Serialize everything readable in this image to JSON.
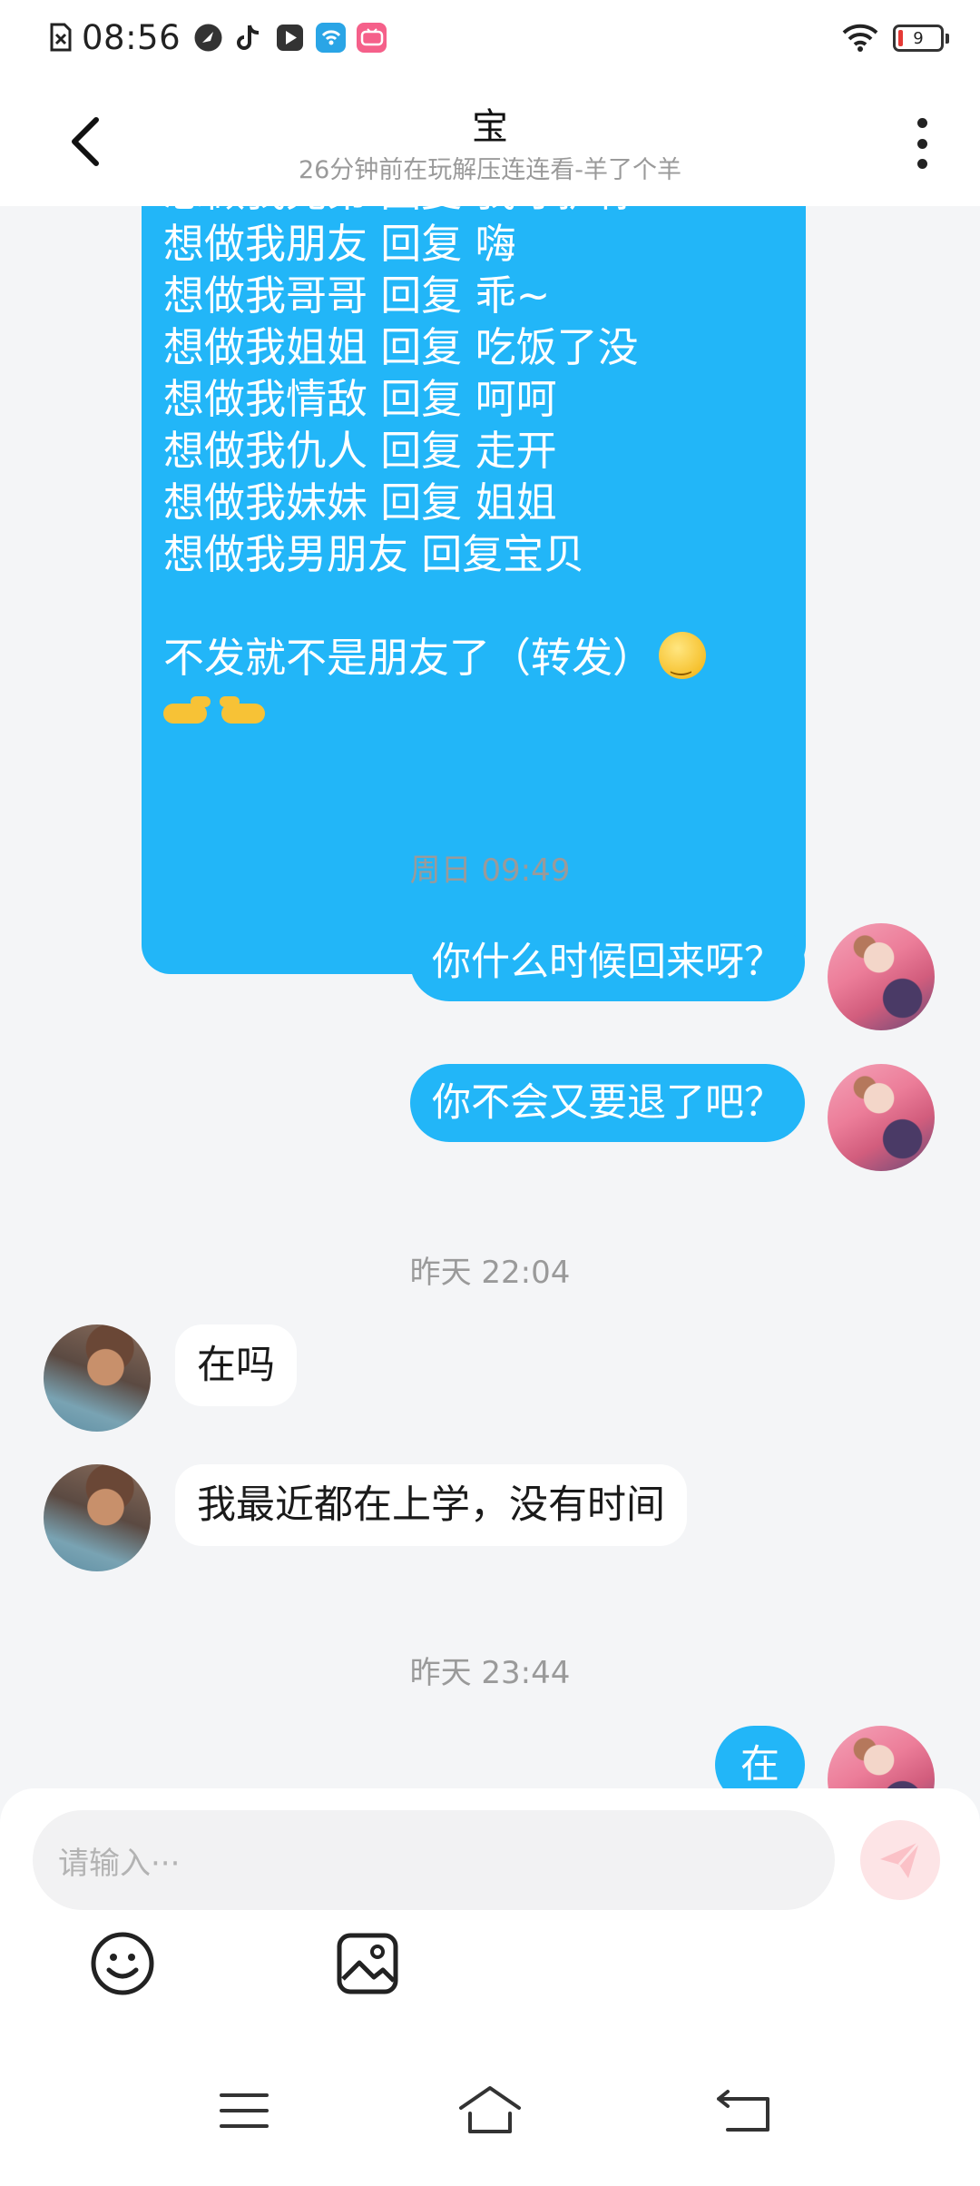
{
  "status_bar": {
    "time": "08:56",
    "battery_level": "9",
    "icons": [
      "no-sim-icon",
      "clock-app-icon",
      "tiktok-icon",
      "video-app-icon",
      "wifi-app-icon",
      "bili-app-icon",
      "wifi-icon",
      "battery-icon"
    ]
  },
  "header": {
    "back_icon": "chevron-left-icon",
    "title": "宝",
    "subtitle": "26分钟前在玩解压连连看-羊了个羊",
    "more_icon": "more-vertical-icon"
  },
  "messages": {
    "long_message": {
      "lines": [
        "想做我兄弟   回复  我守护你",
        "想做我朋友   回复  嗨",
        "想做我哥哥   回复  乖~",
        "想做我姐姐   回复  吃饭了没",
        "想做我情敌   回复  呵呵",
        "想做我仇人   回复  走开",
        "想做我妹妹   回复  姐姐",
        "想做我男朋友   回复宝贝",
        "",
        "不发就不是朋友了（转发）"
      ],
      "emoji_end": "smirk-emoji",
      "emoji_last_line": "pointing-hands-emoji"
    },
    "ts1": "周日 09:49",
    "msg_out_1": "你什么时候回来呀？",
    "msg_out_2": "你不会又要退了吧？",
    "ts2": "昨天 22:04",
    "msg_in_1": "在吗",
    "msg_in_2": "我最近都在上学，没有时间",
    "ts3": "昨天 23:44",
    "msg_out_3": "在"
  },
  "input": {
    "placeholder": "请输入···",
    "send_icon": "send-icon",
    "emoji_icon": "smiley-icon",
    "image_icon": "image-icon"
  },
  "colors": {
    "bubble_out": "#22b6f8",
    "bubble_in": "#ffffff",
    "background": "#f4f5f7",
    "send_button": "#fde4e6"
  },
  "nav_bar": {
    "icons": [
      "menu-icon",
      "home-icon",
      "back-icon"
    ]
  }
}
